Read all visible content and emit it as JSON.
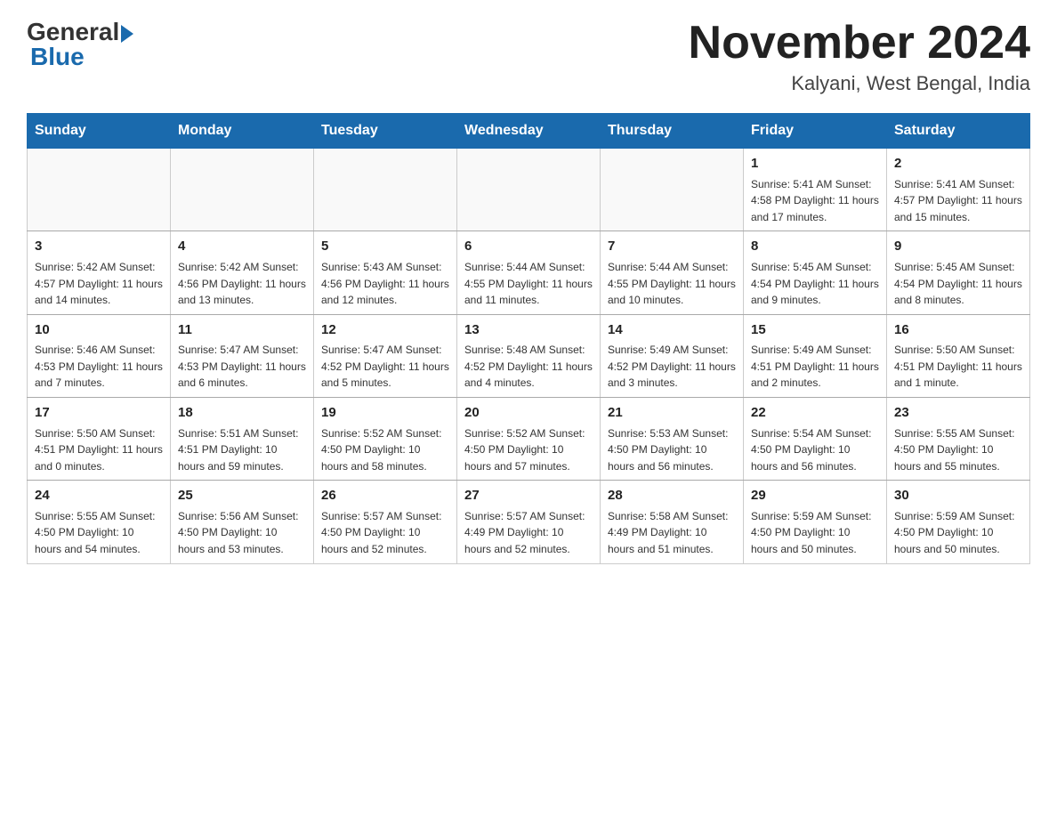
{
  "header": {
    "logo": {
      "general": "General",
      "blue": "Blue",
      "arrow": "▶"
    },
    "title": "November 2024",
    "location": "Kalyani, West Bengal, India"
  },
  "calendar": {
    "days_of_week": [
      "Sunday",
      "Monday",
      "Tuesday",
      "Wednesday",
      "Thursday",
      "Friday",
      "Saturday"
    ],
    "weeks": [
      [
        {
          "day": "",
          "info": ""
        },
        {
          "day": "",
          "info": ""
        },
        {
          "day": "",
          "info": ""
        },
        {
          "day": "",
          "info": ""
        },
        {
          "day": "",
          "info": ""
        },
        {
          "day": "1",
          "info": "Sunrise: 5:41 AM\nSunset: 4:58 PM\nDaylight: 11 hours\nand 17 minutes."
        },
        {
          "day": "2",
          "info": "Sunrise: 5:41 AM\nSunset: 4:57 PM\nDaylight: 11 hours\nand 15 minutes."
        }
      ],
      [
        {
          "day": "3",
          "info": "Sunrise: 5:42 AM\nSunset: 4:57 PM\nDaylight: 11 hours\nand 14 minutes."
        },
        {
          "day": "4",
          "info": "Sunrise: 5:42 AM\nSunset: 4:56 PM\nDaylight: 11 hours\nand 13 minutes."
        },
        {
          "day": "5",
          "info": "Sunrise: 5:43 AM\nSunset: 4:56 PM\nDaylight: 11 hours\nand 12 minutes."
        },
        {
          "day": "6",
          "info": "Sunrise: 5:44 AM\nSunset: 4:55 PM\nDaylight: 11 hours\nand 11 minutes."
        },
        {
          "day": "7",
          "info": "Sunrise: 5:44 AM\nSunset: 4:55 PM\nDaylight: 11 hours\nand 10 minutes."
        },
        {
          "day": "8",
          "info": "Sunrise: 5:45 AM\nSunset: 4:54 PM\nDaylight: 11 hours\nand 9 minutes."
        },
        {
          "day": "9",
          "info": "Sunrise: 5:45 AM\nSunset: 4:54 PM\nDaylight: 11 hours\nand 8 minutes."
        }
      ],
      [
        {
          "day": "10",
          "info": "Sunrise: 5:46 AM\nSunset: 4:53 PM\nDaylight: 11 hours\nand 7 minutes."
        },
        {
          "day": "11",
          "info": "Sunrise: 5:47 AM\nSunset: 4:53 PM\nDaylight: 11 hours\nand 6 minutes."
        },
        {
          "day": "12",
          "info": "Sunrise: 5:47 AM\nSunset: 4:52 PM\nDaylight: 11 hours\nand 5 minutes."
        },
        {
          "day": "13",
          "info": "Sunrise: 5:48 AM\nSunset: 4:52 PM\nDaylight: 11 hours\nand 4 minutes."
        },
        {
          "day": "14",
          "info": "Sunrise: 5:49 AM\nSunset: 4:52 PM\nDaylight: 11 hours\nand 3 minutes."
        },
        {
          "day": "15",
          "info": "Sunrise: 5:49 AM\nSunset: 4:51 PM\nDaylight: 11 hours\nand 2 minutes."
        },
        {
          "day": "16",
          "info": "Sunrise: 5:50 AM\nSunset: 4:51 PM\nDaylight: 11 hours\nand 1 minute."
        }
      ],
      [
        {
          "day": "17",
          "info": "Sunrise: 5:50 AM\nSunset: 4:51 PM\nDaylight: 11 hours\nand 0 minutes."
        },
        {
          "day": "18",
          "info": "Sunrise: 5:51 AM\nSunset: 4:51 PM\nDaylight: 10 hours\nand 59 minutes."
        },
        {
          "day": "19",
          "info": "Sunrise: 5:52 AM\nSunset: 4:50 PM\nDaylight: 10 hours\nand 58 minutes."
        },
        {
          "day": "20",
          "info": "Sunrise: 5:52 AM\nSunset: 4:50 PM\nDaylight: 10 hours\nand 57 minutes."
        },
        {
          "day": "21",
          "info": "Sunrise: 5:53 AM\nSunset: 4:50 PM\nDaylight: 10 hours\nand 56 minutes."
        },
        {
          "day": "22",
          "info": "Sunrise: 5:54 AM\nSunset: 4:50 PM\nDaylight: 10 hours\nand 56 minutes."
        },
        {
          "day": "23",
          "info": "Sunrise: 5:55 AM\nSunset: 4:50 PM\nDaylight: 10 hours\nand 55 minutes."
        }
      ],
      [
        {
          "day": "24",
          "info": "Sunrise: 5:55 AM\nSunset: 4:50 PM\nDaylight: 10 hours\nand 54 minutes."
        },
        {
          "day": "25",
          "info": "Sunrise: 5:56 AM\nSunset: 4:50 PM\nDaylight: 10 hours\nand 53 minutes."
        },
        {
          "day": "26",
          "info": "Sunrise: 5:57 AM\nSunset: 4:50 PM\nDaylight: 10 hours\nand 52 minutes."
        },
        {
          "day": "27",
          "info": "Sunrise: 5:57 AM\nSunset: 4:49 PM\nDaylight: 10 hours\nand 52 minutes."
        },
        {
          "day": "28",
          "info": "Sunrise: 5:58 AM\nSunset: 4:49 PM\nDaylight: 10 hours\nand 51 minutes."
        },
        {
          "day": "29",
          "info": "Sunrise: 5:59 AM\nSunset: 4:50 PM\nDaylight: 10 hours\nand 50 minutes."
        },
        {
          "day": "30",
          "info": "Sunrise: 5:59 AM\nSunset: 4:50 PM\nDaylight: 10 hours\nand 50 minutes."
        }
      ]
    ]
  }
}
